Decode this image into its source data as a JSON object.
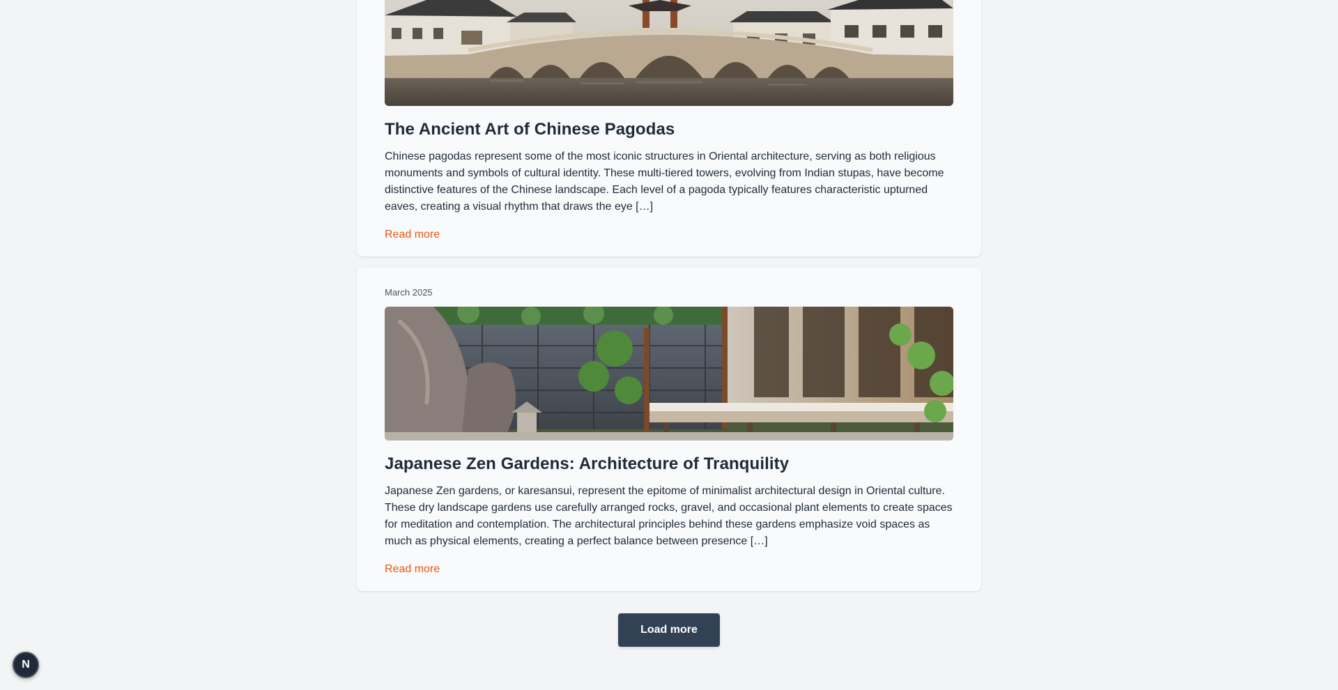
{
  "posts": [
    {
      "date": "",
      "title": "The Ancient Art of Chinese Pagodas",
      "excerpt": "Chinese pagodas represent some of the most iconic structures in Oriental architecture, serving as both religious monuments and symbols of cultural identity. These multi-tiered towers, evolving from Indian stupas, have become distinctive features of the Chinese landscape. Each level of a pagoda typically features characteristic upturned eaves, creating a visual rhythm that draws the eye […]",
      "read_more_label": "Read more"
    },
    {
      "date": "March 2025",
      "title": "Japanese Zen Gardens: Architecture of Tranquility",
      "excerpt": "Japanese Zen gardens, or karesansui, represent the epitome of minimalist architectural design in Oriental culture. These dry landscape gardens use carefully arranged rocks, gravel, and occasional plant elements to create spaces for meditation and contemplation. The architectural principles behind these gardens emphasize void spaces as much as physical elements, creating a perfect balance between presence […]",
      "read_more_label": "Read more"
    }
  ],
  "load_more_label": "Load more",
  "dev_badge_letter": "N",
  "colors": {
    "accent": "#ea580c",
    "button_bg": "#334155",
    "card_bg": "#f8fafc",
    "page_bg": "#f3f4f6"
  }
}
